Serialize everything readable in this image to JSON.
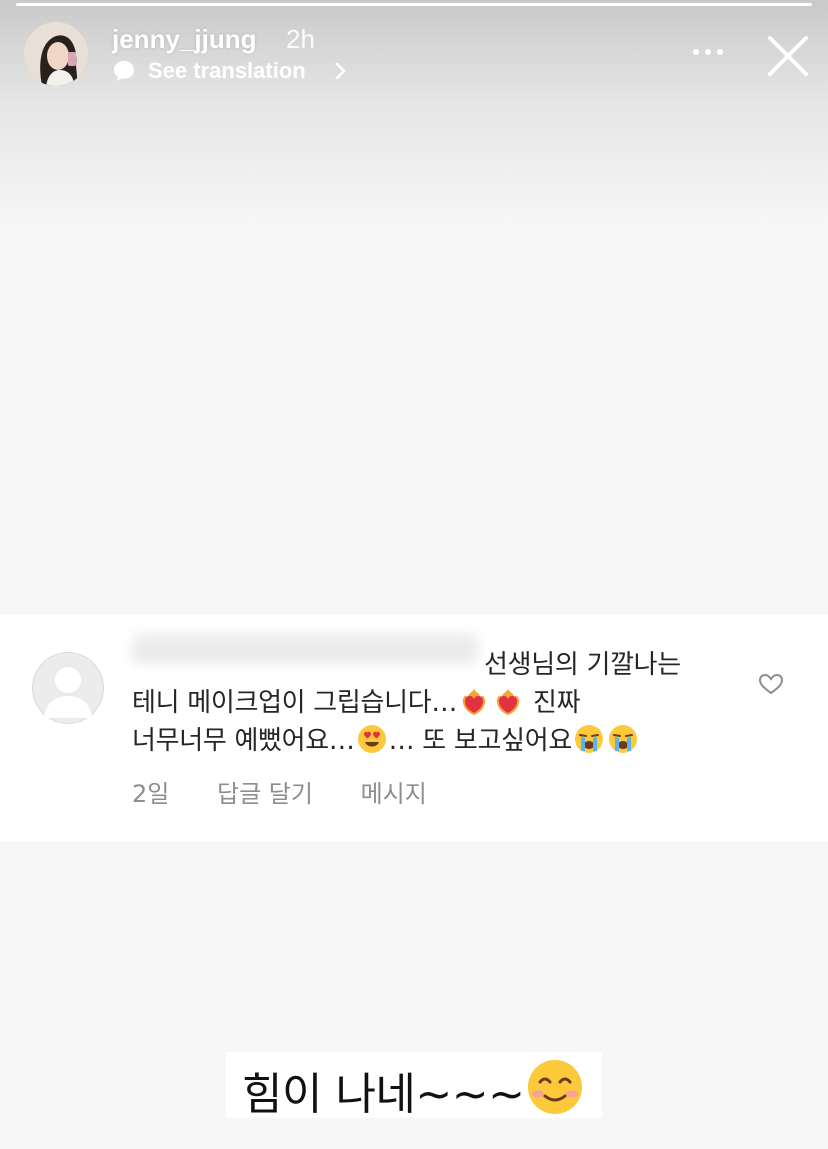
{
  "story": {
    "progress_fraction": 1.0,
    "username": "jenny_jjung",
    "time": "2h",
    "translate_label": "See translation",
    "more_icon": "more-horizontal-icon",
    "close_icon": "close-icon"
  },
  "comment": {
    "line1": "선생님의 기깔나는",
    "line2_a": "테니 메이크업이 그립습니다…",
    "line2_b": "진짜",
    "line3_a": "너무너무 예뻤어요…",
    "line3_b": "… 또 보고싶어요",
    "meta": {
      "time": "2일",
      "reply": "답글 달기",
      "message": "메시지"
    },
    "like_icon": "heart-outline-icon"
  },
  "caption": {
    "text": "힘이 나네~~~",
    "emoji": "smiling-face-emoji"
  },
  "colors": {
    "text_primary": "#262626",
    "text_secondary": "#8e8e8e",
    "overlay_text": "#ffffff"
  }
}
